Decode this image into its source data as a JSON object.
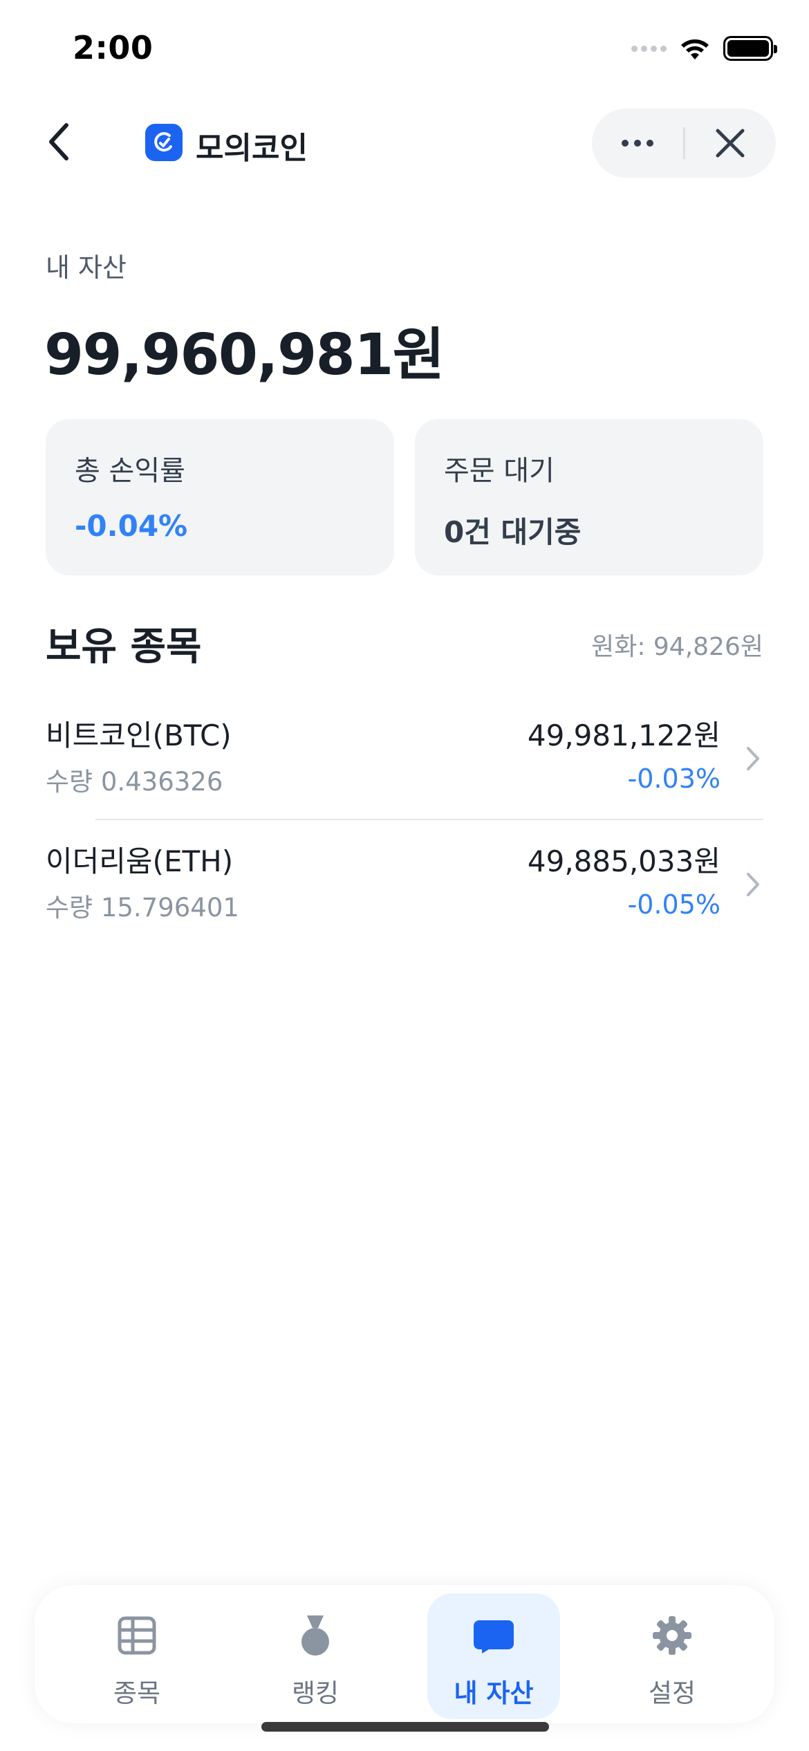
{
  "status_bar": {
    "time": "2:00"
  },
  "nav": {
    "app_title": "모의코인"
  },
  "assets": {
    "label": "내 자산",
    "total": "99,960,981원"
  },
  "cards": {
    "profit": {
      "label": "총 손익률",
      "value": "-0.04%"
    },
    "orders": {
      "label": "주문 대기",
      "value": "0건 대기중"
    }
  },
  "holdings": {
    "title": "보유 종목",
    "cash": "원화: 94,826원",
    "items": [
      {
        "name": "비트코인(BTC)",
        "qty": "수량 0.436326",
        "value": "49,981,122원",
        "change": "-0.03%"
      },
      {
        "name": "이더리움(ETH)",
        "qty": "수량 15.796401",
        "value": "49,885,033원",
        "change": "-0.05%"
      }
    ]
  },
  "tabbar": {
    "tabs": [
      {
        "label": "종목",
        "icon": "table-icon"
      },
      {
        "label": "랭킹",
        "icon": "medal-icon"
      },
      {
        "label": "내 자산",
        "icon": "wallet-icon",
        "active": true
      },
      {
        "label": "설정",
        "icon": "gear-icon"
      }
    ]
  },
  "colors": {
    "accent": "#1b64f2",
    "negative": "#3182f6",
    "card_bg": "#f2f4f6",
    "active_tab_bg": "#e8f3ff"
  }
}
